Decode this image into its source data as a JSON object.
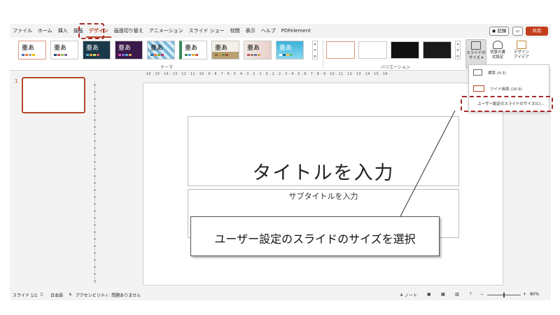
{
  "ribbon": {
    "tabs": [
      "ファイル",
      "ホーム",
      "挿入",
      "描画",
      "デザイン",
      "画面切り替え",
      "アニメーション",
      "スライド ショー",
      "校閲",
      "表示",
      "ヘルプ",
      "PDFelement"
    ],
    "active_tab": "デザイン",
    "record_label": "◉ 記録",
    "comment_label": "▭",
    "share_label": "共有",
    "theme_sample_text": "亜あ",
    "theme_group_label": "テーマ",
    "variation_group_label": "バリエーション",
    "slide_size_label": "スライドのサイズ",
    "format_background_label": "背景の書式設定",
    "designer_label": "デザイナー",
    "slide_size_label_l1": "スライドの",
    "slide_size_label_l2": "サイズ ▾",
    "format_bg_l1": "背景の書",
    "format_bg_l2": "式設定",
    "designer_l1": "デザイン",
    "designer_l2": "アイデア"
  },
  "dropdown": {
    "standard": "標準 (4:3)",
    "widescreen": "ワイド画面 (16:9)",
    "custom": "ユーザー設定のスライドのサイズ(C)..."
  },
  "slides_pane": {
    "slide_number": "1"
  },
  "ruler": {
    "horizontal": "· 16 · 15 · 14 · 13 · 12 · 11 · 10 · 9 · 8 · 7 · 6 · 5 · 4 · 3 · 2 · 1 · 0 · 1 · 2 · 3 · 4 · 5 · 6 · 7 · 8 · 9 · 10 · 11 · 12 · 13 · 14 · 15 · 16 ·"
  },
  "slide": {
    "title_placeholder": "タイトルを入力",
    "subtitle_placeholder": "サブタイトルを入力"
  },
  "status_bar": {
    "slide_info": "スライド 1/1",
    "language": "日本語",
    "accessibility": "アクセシビリティ: 問題ありません",
    "notes": "≜ ノート",
    "zoom": "80%"
  },
  "annotation": {
    "text": "ユーザー設定のスライドのサイズを選択"
  },
  "colors": {
    "accent": "#b7472a",
    "share": "#c43e1c",
    "callout_border": "#a82a2a"
  }
}
